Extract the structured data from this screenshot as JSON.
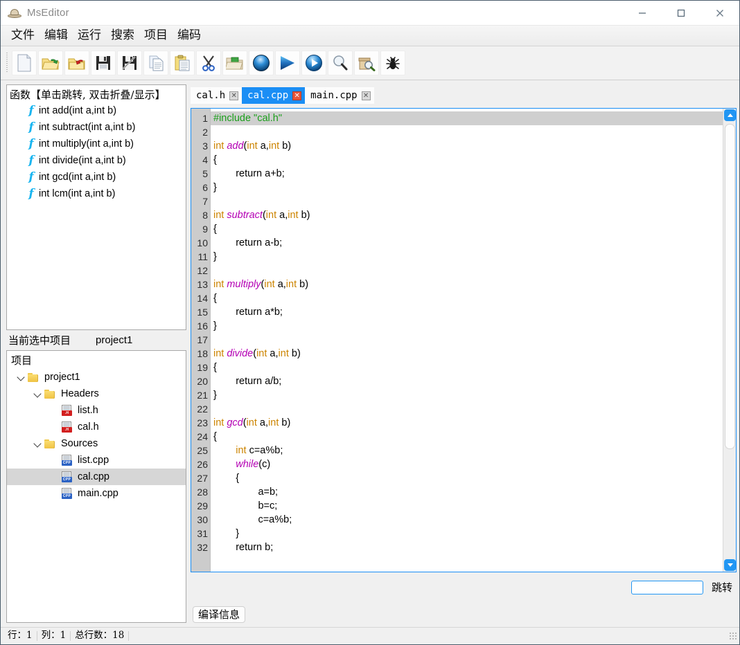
{
  "window": {
    "title": "MsEditor",
    "icon": "hat-icon",
    "controls": [
      {
        "name": "minimize-button",
        "glyph": "minimize-icon"
      },
      {
        "name": "maximize-button",
        "glyph": "maximize-icon"
      },
      {
        "name": "close-button",
        "glyph": "close-icon"
      }
    ]
  },
  "menubar": {
    "items": [
      {
        "label": "文件",
        "name": "menu-file"
      },
      {
        "label": "编辑",
        "name": "menu-edit"
      },
      {
        "label": "运行",
        "name": "menu-run"
      },
      {
        "label": "搜索",
        "name": "menu-search"
      },
      {
        "label": "项目",
        "name": "menu-project"
      },
      {
        "label": "编码",
        "name": "menu-encoding"
      }
    ]
  },
  "toolbar": {
    "buttons": [
      {
        "name": "new-file-button",
        "icon": "new-file-icon"
      },
      {
        "name": "open-file-button",
        "icon": "open-folder-green-arrow-icon"
      },
      {
        "name": "close-file-button",
        "icon": "open-folder-red-arrow-icon"
      },
      {
        "name": "save-button",
        "icon": "floppy-disk-icon"
      },
      {
        "name": "save-as-button",
        "icon": "floppy-disk-pen-icon"
      },
      {
        "name": "copy-button",
        "icon": "copy-pages-icon"
      },
      {
        "name": "paste-button",
        "icon": "clipboard-icon"
      },
      {
        "name": "cut-button",
        "icon": "scissors-icon"
      },
      {
        "name": "open-project-button",
        "icon": "folder-green-file-icon"
      },
      {
        "name": "compile-button",
        "icon": "blue-sphere-icon"
      },
      {
        "name": "run-button",
        "icon": "blue-play-triangle-icon"
      },
      {
        "name": "compile-run-button",
        "icon": "blue-circle-play-icon"
      },
      {
        "name": "find-button",
        "icon": "magnifier-icon"
      },
      {
        "name": "find-in-files-button",
        "icon": "box-magnifier-icon"
      },
      {
        "name": "debug-button",
        "icon": "bug-icon"
      }
    ]
  },
  "function_panel": {
    "header": "函数【单击跳转, 双击折叠/显示】",
    "items": [
      {
        "label": "int add(int a,int b)"
      },
      {
        "label": "int subtract(int a,int b)"
      },
      {
        "label": "int multiply(int a,int b)"
      },
      {
        "label": "int divide(int a,int b)"
      },
      {
        "label": "int gcd(int a,int b)"
      },
      {
        "label": "int lcm(int a,int b)"
      }
    ]
  },
  "current_project": {
    "label": "当前选中项目",
    "value": "project1"
  },
  "project_tree": {
    "header": "项目",
    "nodes": [
      {
        "label": "project1",
        "type": "folder",
        "indent": 0,
        "expanded": true,
        "selected": false
      },
      {
        "label": "Headers",
        "type": "folder",
        "indent": 1,
        "expanded": true,
        "selected": false
      },
      {
        "label": "list.h",
        "type": "file-h",
        "indent": 2,
        "selected": false
      },
      {
        "label": "cal.h",
        "type": "file-h",
        "indent": 2,
        "selected": false
      },
      {
        "label": "Sources",
        "type": "folder",
        "indent": 1,
        "expanded": true,
        "selected": false
      },
      {
        "label": "list.cpp",
        "type": "file-cpp",
        "indent": 2,
        "selected": false
      },
      {
        "label": "cal.cpp",
        "type": "file-cpp",
        "indent": 2,
        "selected": true
      },
      {
        "label": "main.cpp",
        "type": "file-cpp",
        "indent": 2,
        "selected": false
      }
    ]
  },
  "editor_tabs": [
    {
      "label": "cal.h",
      "active": false,
      "close": "✕"
    },
    {
      "label": "cal.cpp",
      "active": true,
      "close": "✕"
    },
    {
      "label": "main.cpp",
      "active": false,
      "close": "✕"
    }
  ],
  "editor": {
    "current_line": 1,
    "lines": [
      {
        "n": 1,
        "tokens": [
          {
            "t": "#include \"cal.h\"",
            "c": "pp"
          }
        ]
      },
      {
        "n": 2,
        "tokens": []
      },
      {
        "n": 3,
        "tokens": [
          {
            "t": "int ",
            "c": "kw"
          },
          {
            "t": "add",
            "c": "fn"
          },
          {
            "t": "(",
            "c": ""
          },
          {
            "t": "int",
            "c": "kw"
          },
          {
            "t": " a,",
            "c": ""
          },
          {
            "t": "int",
            "c": "kw"
          },
          {
            "t": " b)",
            "c": ""
          }
        ]
      },
      {
        "n": 4,
        "tokens": [
          {
            "t": "{",
            "c": ""
          }
        ]
      },
      {
        "n": 5,
        "tokens": [
          {
            "t": "        return a+b;",
            "c": ""
          }
        ]
      },
      {
        "n": 6,
        "tokens": [
          {
            "t": "}",
            "c": ""
          }
        ]
      },
      {
        "n": 7,
        "tokens": []
      },
      {
        "n": 8,
        "tokens": [
          {
            "t": "int ",
            "c": "kw"
          },
          {
            "t": "subtract",
            "c": "fn"
          },
          {
            "t": "(",
            "c": ""
          },
          {
            "t": "int",
            "c": "kw"
          },
          {
            "t": " a,",
            "c": ""
          },
          {
            "t": "int",
            "c": "kw"
          },
          {
            "t": " b)",
            "c": ""
          }
        ]
      },
      {
        "n": 9,
        "tokens": [
          {
            "t": "{",
            "c": ""
          }
        ]
      },
      {
        "n": 10,
        "tokens": [
          {
            "t": "        return a-b;",
            "c": ""
          }
        ]
      },
      {
        "n": 11,
        "tokens": [
          {
            "t": "}",
            "c": ""
          }
        ]
      },
      {
        "n": 12,
        "tokens": []
      },
      {
        "n": 13,
        "tokens": [
          {
            "t": "int ",
            "c": "kw"
          },
          {
            "t": "multiply",
            "c": "fn"
          },
          {
            "t": "(",
            "c": ""
          },
          {
            "t": "int",
            "c": "kw"
          },
          {
            "t": " a,",
            "c": ""
          },
          {
            "t": "int",
            "c": "kw"
          },
          {
            "t": " b)",
            "c": ""
          }
        ]
      },
      {
        "n": 14,
        "tokens": [
          {
            "t": "{",
            "c": ""
          }
        ]
      },
      {
        "n": 15,
        "tokens": [
          {
            "t": "        return a*b;",
            "c": ""
          }
        ]
      },
      {
        "n": 16,
        "tokens": [
          {
            "t": "}",
            "c": ""
          }
        ]
      },
      {
        "n": 17,
        "tokens": []
      },
      {
        "n": 18,
        "tokens": [
          {
            "t": "int ",
            "c": "kw"
          },
          {
            "t": "divide",
            "c": "fn"
          },
          {
            "t": "(",
            "c": ""
          },
          {
            "t": "int",
            "c": "kw"
          },
          {
            "t": " a,",
            "c": ""
          },
          {
            "t": "int",
            "c": "kw"
          },
          {
            "t": " b)",
            "c": ""
          }
        ]
      },
      {
        "n": 19,
        "tokens": [
          {
            "t": "{",
            "c": ""
          }
        ]
      },
      {
        "n": 20,
        "tokens": [
          {
            "t": "        return a/b;",
            "c": ""
          }
        ]
      },
      {
        "n": 21,
        "tokens": [
          {
            "t": "}",
            "c": ""
          }
        ]
      },
      {
        "n": 22,
        "tokens": []
      },
      {
        "n": 23,
        "tokens": [
          {
            "t": "int ",
            "c": "kw"
          },
          {
            "t": "gcd",
            "c": "fn"
          },
          {
            "t": "(",
            "c": ""
          },
          {
            "t": "int",
            "c": "kw"
          },
          {
            "t": " a,",
            "c": ""
          },
          {
            "t": "int",
            "c": "kw"
          },
          {
            "t": " b)",
            "c": ""
          }
        ]
      },
      {
        "n": 24,
        "tokens": [
          {
            "t": "{",
            "c": ""
          }
        ]
      },
      {
        "n": 25,
        "tokens": [
          {
            "t": "        ",
            "c": ""
          },
          {
            "t": "int",
            "c": "kw"
          },
          {
            "t": " c=a%b;",
            "c": ""
          }
        ]
      },
      {
        "n": 26,
        "tokens": [
          {
            "t": "        ",
            "c": ""
          },
          {
            "t": "while",
            "c": "fn"
          },
          {
            "t": "(c)",
            "c": ""
          }
        ]
      },
      {
        "n": 27,
        "tokens": [
          {
            "t": "        {",
            "c": ""
          }
        ]
      },
      {
        "n": 28,
        "tokens": [
          {
            "t": "                a=b;",
            "c": ""
          }
        ]
      },
      {
        "n": 29,
        "tokens": [
          {
            "t": "                b=c;",
            "c": ""
          }
        ]
      },
      {
        "n": 30,
        "tokens": [
          {
            "t": "                c=a%b;",
            "c": ""
          }
        ]
      },
      {
        "n": 31,
        "tokens": [
          {
            "t": "        }",
            "c": ""
          }
        ]
      },
      {
        "n": 32,
        "tokens": [
          {
            "t": "        return b;",
            "c": ""
          }
        ]
      }
    ]
  },
  "jump": {
    "input_value": "",
    "placeholder": "",
    "button_label": "跳转"
  },
  "bottom_tabs": [
    {
      "label": "编译信息",
      "name": "tab-compile-info"
    }
  ],
  "statusbar": {
    "cells": [
      "行：1",
      "列：1",
      "总行数：18"
    ]
  },
  "colors": {
    "accent_blue": "#1a8ef5",
    "tab_active_bg": "#1a8ef5",
    "keyword": "#cc8400",
    "function": "#b400b4",
    "string": "#1a9e1a",
    "gutter": "#cccccc",
    "selection": "#d6d6d6"
  }
}
